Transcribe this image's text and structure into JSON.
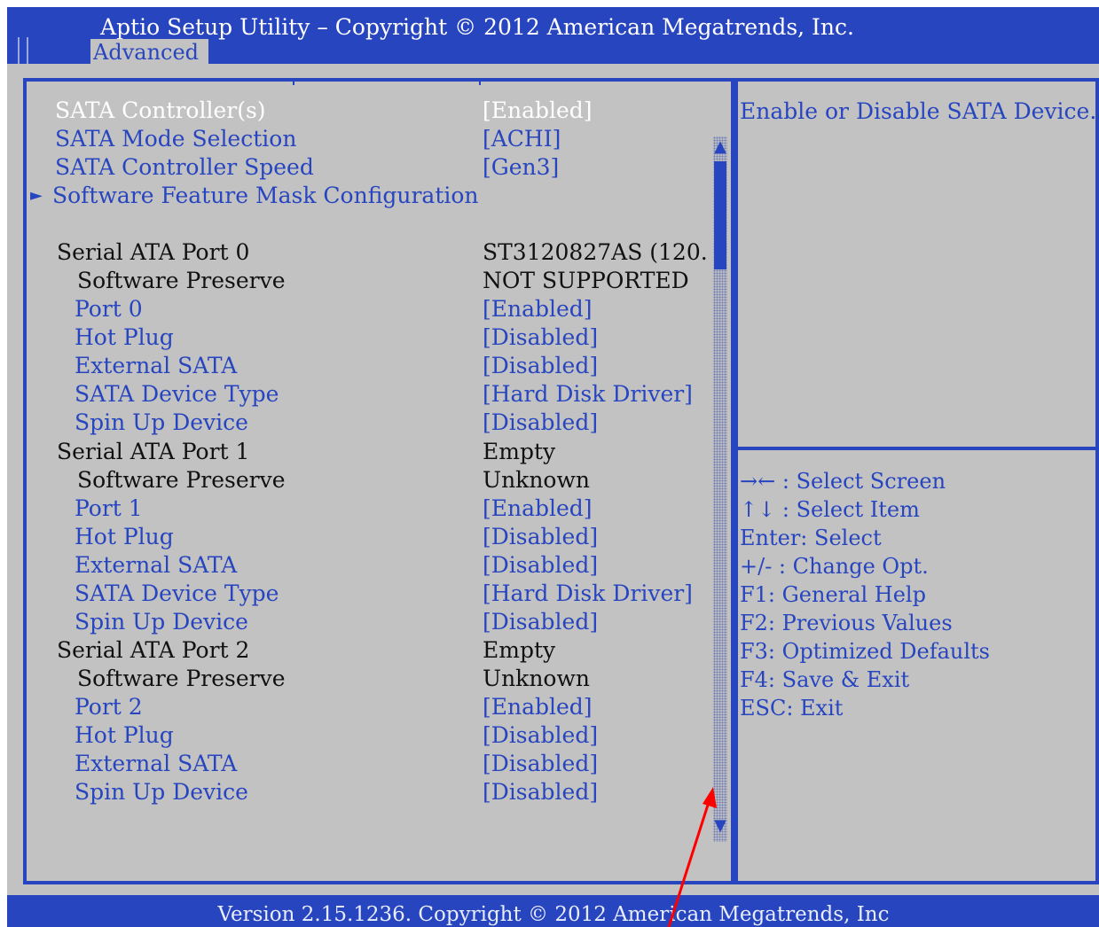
{
  "header": {
    "title": "Aptio Setup Utility  –  Copyright © 2012 American Megatrends, Inc.",
    "tab": "Advanced"
  },
  "main": {
    "rows": [
      {
        "label": "SATA Controller(s)",
        "value": "[Enabled]"
      },
      {
        "label": "SATA Mode Selection",
        "value": "[ACHI]"
      },
      {
        "label": "SATA Controller Speed",
        "value": "[Gen3]"
      },
      {
        "label": "Software Feature Mask Configuration",
        "value": ""
      },
      {
        "label": "Serial ATA Port 0",
        "value": "ST3120827AS  (120."
      },
      {
        "label": "Software Preserve",
        "value": "NOT SUPPORTED"
      },
      {
        "label": "Port 0",
        "value": "[Enabled]"
      },
      {
        "label": "Hot Plug",
        "value": "[Disabled]"
      },
      {
        "label": "External SATA",
        "value": "[Disabled]"
      },
      {
        "label": "SATA Device Type",
        "value": "[Hard Disk Driver]"
      },
      {
        "label": "Spin Up Device",
        "value": "[Disabled]"
      },
      {
        "label": "Serial ATA Port 1",
        "value": "Empty"
      },
      {
        "label": "Software Preserve",
        "value": "Unknown"
      },
      {
        "label": "Port 1",
        "value": "[Enabled]"
      },
      {
        "label": "Hot Plug",
        "value": "[Disabled]"
      },
      {
        "label": "External SATA",
        "value": "[Disabled]"
      },
      {
        "label": "SATA Device Type",
        "value": "[Hard Disk Driver]"
      },
      {
        "label": "Spin Up Device",
        "value": "[Disabled]"
      },
      {
        "label": "Serial ATA Port 2",
        "value": "Empty"
      },
      {
        "label": "Software Preserve",
        "value": "Unknown"
      },
      {
        "label": "Port 2",
        "value": "[Enabled]"
      },
      {
        "label": "Hot Plug",
        "value": "[Disabled]"
      },
      {
        "label": "External SATA",
        "value": "[Disabled]"
      },
      {
        "label": "Spin Up Device",
        "value": "[Disabled]"
      }
    ],
    "submenu_marker": "►",
    "scroll_up_icon": "▲",
    "scroll_down_icon": "▼"
  },
  "help": {
    "text": "Enable or Disable SATA Device."
  },
  "keys": [
    "→← : Select Screen",
    "↑↓ : Select Item",
    "Enter: Select",
    "+/- : Change Opt.",
    "F1: General Help",
    "F2: Previous Values",
    "F3: Optimized Defaults",
    "F4: Save & Exit",
    "ESC: Exit"
  ],
  "footer": {
    "version": "Version 2.15.1236. Copyright © 2012 American Megatrends, Inc"
  },
  "colors": {
    "bios_blue": "#2845c0",
    "panel_gray": "#c2c2c2",
    "annotation_red": "#ff0000"
  }
}
